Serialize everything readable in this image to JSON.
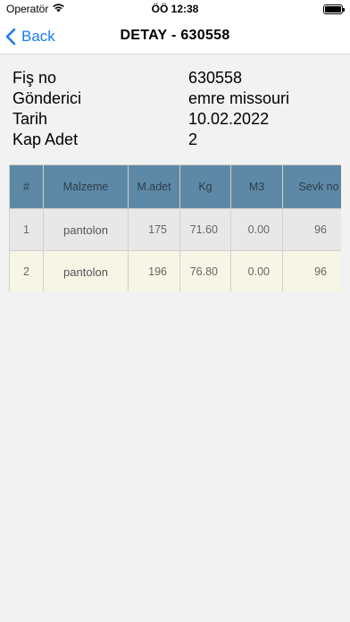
{
  "status_bar": {
    "carrier": "Operatör",
    "time": "ÖÖ 12:38"
  },
  "nav": {
    "back_label": "Back",
    "title": "DETAY - 630558"
  },
  "info": [
    {
      "label": "Fiş no",
      "value": "630558"
    },
    {
      "label": "Gönderici",
      "value": "emre missouri"
    },
    {
      "label": "Tarih",
      "value": "10.02.2022"
    },
    {
      "label": "Kap Adet",
      "value": "2"
    }
  ],
  "table": {
    "headers": [
      "#",
      "Malzeme",
      "M.adet",
      "Kg",
      "M3",
      "Sevk no"
    ],
    "rows": [
      [
        "1",
        "pantolon",
        "175",
        "71.60",
        "0.00",
        "96"
      ],
      [
        "2",
        "pantolon",
        "196",
        "76.80",
        "0.00",
        "96"
      ]
    ]
  },
  "colors": {
    "accent": "#1a7cf3",
    "table_header": "#5e89a6",
    "row_odd": "#e8e8e8",
    "row_even": "#f7f5e6"
  }
}
